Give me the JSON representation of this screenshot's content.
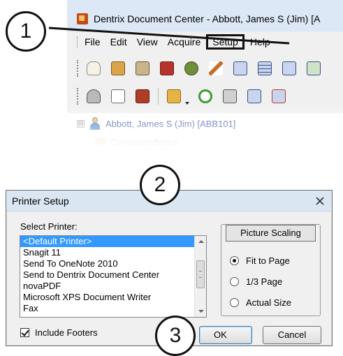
{
  "window": {
    "title": "Dentrix Document Center - Abbott, James S (Jim) [A",
    "menu": [
      "File",
      "Edit",
      "View",
      "Acquire",
      "Setup",
      "Help"
    ],
    "toolbar1_icons": [
      "tooth-icon",
      "image-icon",
      "clipboard-icon",
      "book-icon",
      "person-chair-icon",
      "pen-icon",
      "card-icon",
      "card-lines-icon",
      "camera-card-icon",
      "card-check-icon"
    ],
    "toolbar2_icons": [
      "scanner-icon",
      "document-arrow-icon",
      "binder-icon",
      "folder-open-icon",
      "refresh-icon",
      "printer-icon",
      "card-icon",
      "card-arrow-icon"
    ],
    "tree": {
      "expander": "⊟",
      "patient": "Abbott, James S (Jim) [ABB101]",
      "child": "Correspondence"
    }
  },
  "callouts": [
    "1",
    "2",
    "3"
  ],
  "dialog": {
    "title": "Printer Setup",
    "select_label": "Select Printer:",
    "printers": [
      "<Default Printer>",
      "Snagit 11",
      "Send To OneNote 2010",
      "Send to Dentrix Document Center",
      "novaPDF",
      "Microsoft XPS Document Writer",
      "Fax"
    ],
    "selected_index": 0,
    "include_footers_label": "Include Footers",
    "include_footers_checked": true,
    "scaling": {
      "heading": "Picture Scaling",
      "options": [
        "Fit to Page",
        "1/3 Page",
        "Actual Size"
      ],
      "selected": "Fit to Page"
    },
    "ok_label": "OK",
    "cancel_label": "Cancel"
  }
}
